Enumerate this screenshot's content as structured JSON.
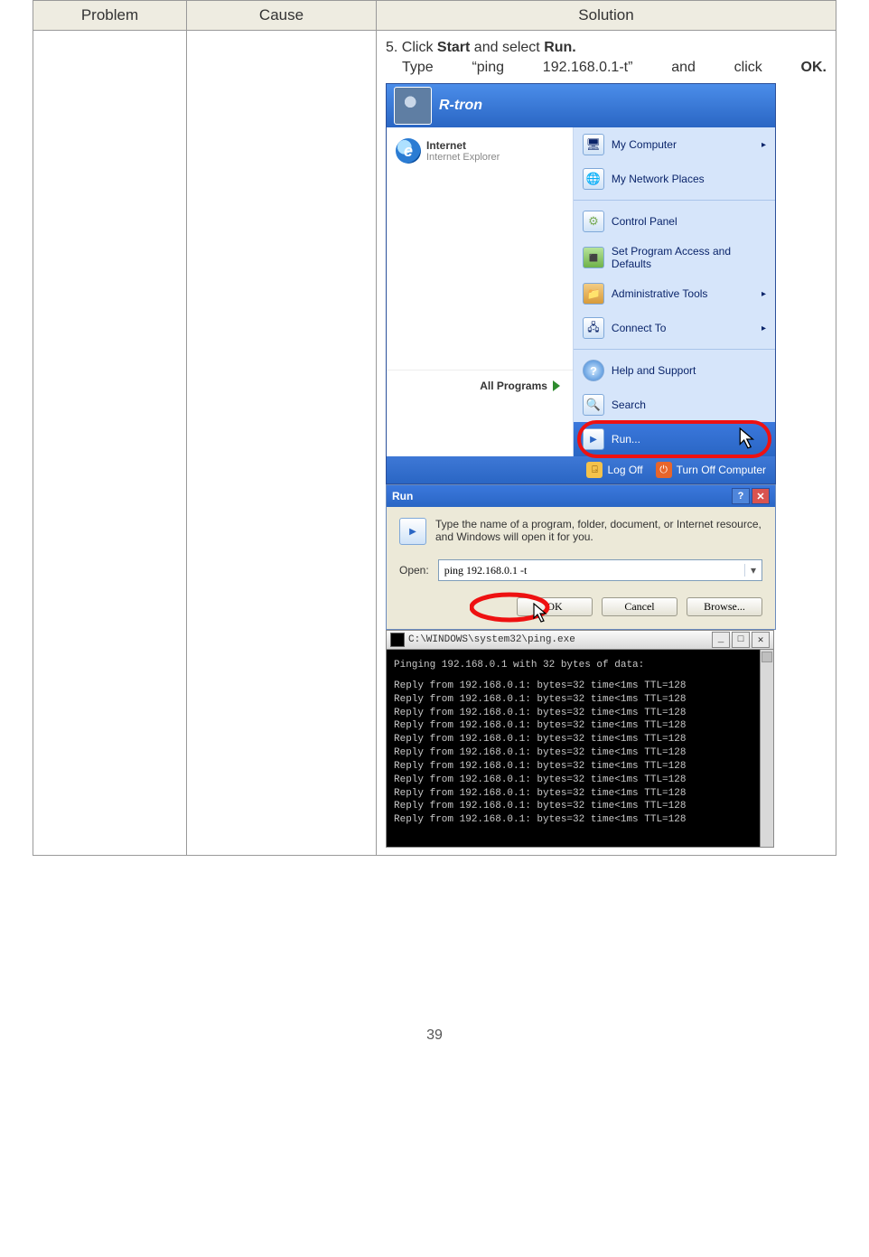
{
  "table": {
    "headers": {
      "problem": "Problem",
      "cause": "Cause",
      "solution": "Solution"
    }
  },
  "step": {
    "line1_prefix": "5. Click ",
    "line1_bold1": "Start",
    "line1_mid": " and select ",
    "line1_bold2": "Run.",
    "line2_a": "Type",
    "line2_b": "“ping",
    "line2_c": "192.168.0.1-t”",
    "line2_d": "and",
    "line2_e": "click",
    "line2_f": "OK."
  },
  "start_menu": {
    "user": "R-tron",
    "pinned": {
      "title": "Internet",
      "subtitle": "Internet Explorer"
    },
    "all_programs": "All Programs",
    "right_items": [
      {
        "label": "My Computer",
        "arrow": true
      },
      {
        "label": "My Network Places"
      },
      {
        "sep": true
      },
      {
        "label": "Control Panel"
      },
      {
        "label": "Set Program Access and\nDefaults"
      },
      {
        "label": "Administrative Tools",
        "arrow": true
      },
      {
        "label": "Connect To",
        "arrow": true
      },
      {
        "sep": true
      },
      {
        "label": "Help and Support"
      },
      {
        "label": "Search"
      },
      {
        "label": "Run...",
        "highlight": true
      }
    ],
    "footer": {
      "logoff": "Log Off",
      "turnoff": "Turn Off Computer"
    }
  },
  "run_dialog": {
    "title": "Run",
    "description": "Type the name of a program, folder, document, or Internet resource, and Windows will open it for you.",
    "open_label": "Open:",
    "open_value": "ping 192.168.0.1 -t",
    "buttons": {
      "ok": "OK",
      "cancel": "Cancel",
      "browse": "Browse..."
    }
  },
  "cmd": {
    "title": "C:\\WINDOWS\\system32\\ping.exe",
    "header": "Pinging 192.168.0.1 with 32 bytes of data:",
    "reply_line": "Reply from 192.168.0.1: bytes=32 time<1ms TTL=128",
    "reply_count": 11
  },
  "page_number": "39"
}
